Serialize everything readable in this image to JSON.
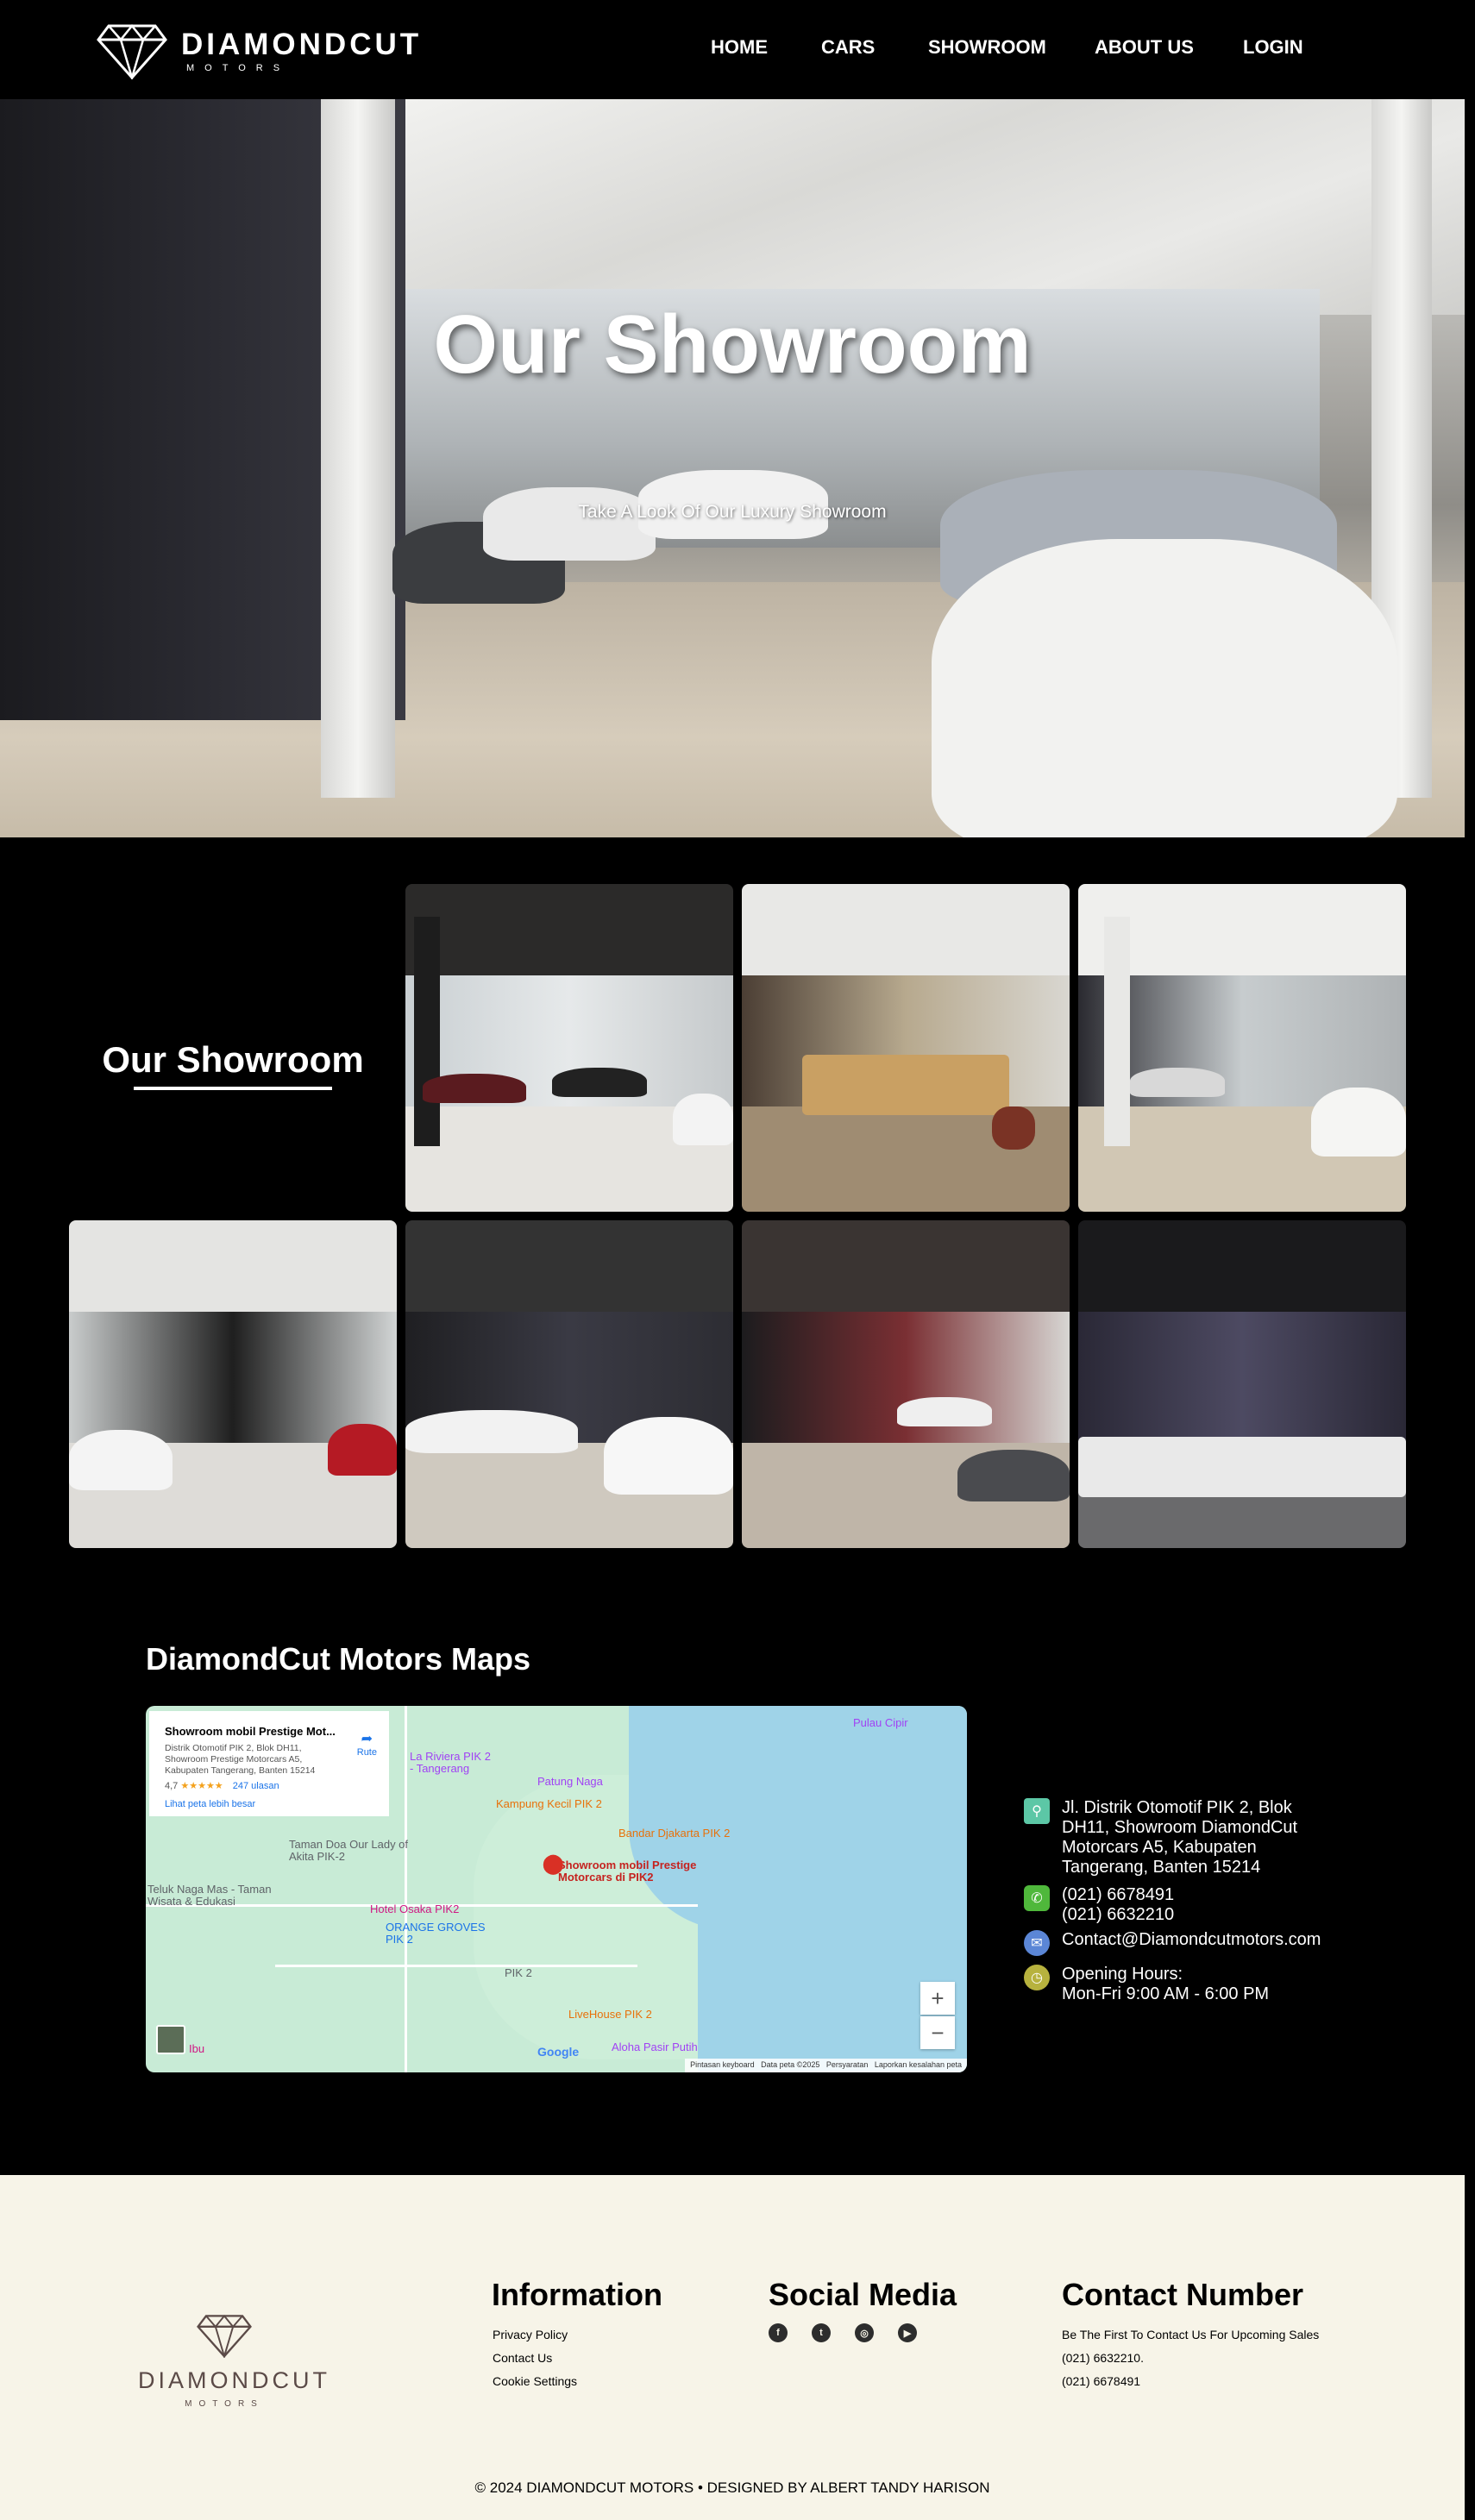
{
  "nav": {
    "logo_main": "DIAMONDCUT",
    "logo_sub": "MOTORS",
    "items": [
      "HOME",
      "CARS",
      "SHOWROOM",
      "ABOUT US",
      "LOGIN"
    ]
  },
  "hero": {
    "title": "Our Showroom",
    "subtitle": "Take A Look Of Our Luxury Showroom"
  },
  "gallery": {
    "title": "Our Showroom",
    "image_count": 7
  },
  "maps": {
    "title": "DiamondCut Motors Maps",
    "card": {
      "name": "Showroom mobil Prestige Mot...",
      "address": "Distrik Otomotif PIK 2, Blok DH11, Showroom Prestige Motorcars A5, Kabupaten Tangerang, Banten 15214",
      "rating": "4,7",
      "stars": "★★★★★",
      "reviews": "247 ulasan",
      "larger_map": "Lihat peta lebih besar",
      "route": "Rute"
    },
    "labels": {
      "pulau_cipir": "Pulau Cipir",
      "la_riviera": "La Riviera PIK 2 - Tangerang",
      "patung_naga": "Patung Naga",
      "kampung_kecil": "Kampung Kecil PIK 2",
      "bandar_djakarta": "Bandar Djakarta PIK 2",
      "taman_doa": "Taman Doa Our Lady of Akita PIK-2",
      "showroom_pin": "Showroom mobil Prestige Motorcars di PIK2",
      "teluk_naga": "Teluk Naga Mas - Taman Wisata & Edukasi",
      "hotel_osaka": "Hotel Osaka PIK2",
      "orange_groves": "ORANGE GROVES PIK 2",
      "pik2": "PIK 2",
      "livehouse": "LiveHouse PIK 2",
      "aloha": "Aloha Pasir Putih",
      "ibu": "Ibu",
      "google": "Google"
    },
    "footer_links": [
      "Pintasan keyboard",
      "Data peta ©2025",
      "Persyaratan",
      "Laporkan kesalahan peta"
    ],
    "zoom_in": "+",
    "zoom_out": "−"
  },
  "contact": {
    "address": "Jl. Distrik Otomotif PIK 2, Blok DH11, Showroom DiamondCut Motorcars A5, Kabupaten Tangerang, Banten 15214",
    "phone1": "(021) 6678491",
    "phone2": "(021) 6632210",
    "email": "Contact@Diamondcutmotors.com",
    "hours_label": "Opening Hours:",
    "hours": "Mon-Fri 9:00 AM - 6:00 PM"
  },
  "footer": {
    "logo_main": "DIAMONDCUT",
    "logo_sub": "MOTORS",
    "information": {
      "title": "Information",
      "links": [
        "Privacy Policy",
        "Contact Us",
        "Cookie Settings"
      ]
    },
    "social": {
      "title": "Social Media",
      "icons": [
        "facebook-icon",
        "twitter-icon",
        "instagram-icon",
        "youtube-icon"
      ]
    },
    "contact_number": {
      "title": "Contact Number",
      "lines": [
        "Be The First To Contact Us For Upcoming Sales",
        "(021) 6632210.",
        "(021) 6678491"
      ]
    },
    "copyright": "© 2024 DIAMONDCUT MOTORS • DESIGNED BY ALBERT TANDY HARISON"
  }
}
